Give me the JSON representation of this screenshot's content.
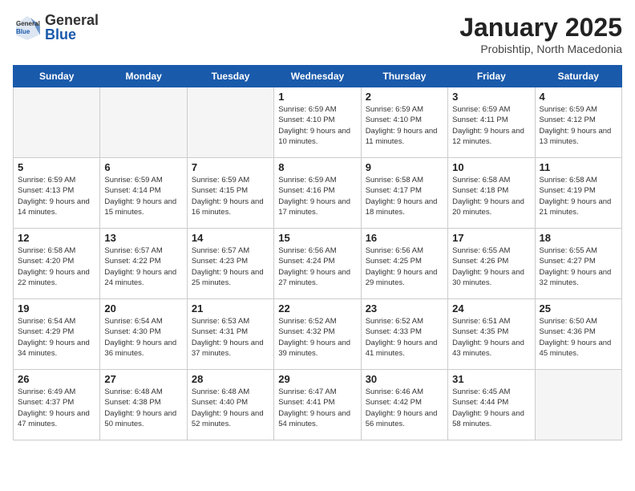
{
  "header": {
    "logo": {
      "general": "General",
      "blue": "Blue"
    },
    "title": "January 2025",
    "location": "Probishtip, North Macedonia"
  },
  "weekdays": [
    "Sunday",
    "Monday",
    "Tuesday",
    "Wednesday",
    "Thursday",
    "Friday",
    "Saturday"
  ],
  "weeks": [
    [
      {
        "day": "",
        "info": ""
      },
      {
        "day": "",
        "info": ""
      },
      {
        "day": "",
        "info": ""
      },
      {
        "day": "1",
        "info": "Sunrise: 6:59 AM\nSunset: 4:10 PM\nDaylight: 9 hours\nand 10 minutes."
      },
      {
        "day": "2",
        "info": "Sunrise: 6:59 AM\nSunset: 4:10 PM\nDaylight: 9 hours\nand 11 minutes."
      },
      {
        "day": "3",
        "info": "Sunrise: 6:59 AM\nSunset: 4:11 PM\nDaylight: 9 hours\nand 12 minutes."
      },
      {
        "day": "4",
        "info": "Sunrise: 6:59 AM\nSunset: 4:12 PM\nDaylight: 9 hours\nand 13 minutes."
      }
    ],
    [
      {
        "day": "5",
        "info": "Sunrise: 6:59 AM\nSunset: 4:13 PM\nDaylight: 9 hours\nand 14 minutes."
      },
      {
        "day": "6",
        "info": "Sunrise: 6:59 AM\nSunset: 4:14 PM\nDaylight: 9 hours\nand 15 minutes."
      },
      {
        "day": "7",
        "info": "Sunrise: 6:59 AM\nSunset: 4:15 PM\nDaylight: 9 hours\nand 16 minutes."
      },
      {
        "day": "8",
        "info": "Sunrise: 6:59 AM\nSunset: 4:16 PM\nDaylight: 9 hours\nand 17 minutes."
      },
      {
        "day": "9",
        "info": "Sunrise: 6:58 AM\nSunset: 4:17 PM\nDaylight: 9 hours\nand 18 minutes."
      },
      {
        "day": "10",
        "info": "Sunrise: 6:58 AM\nSunset: 4:18 PM\nDaylight: 9 hours\nand 20 minutes."
      },
      {
        "day": "11",
        "info": "Sunrise: 6:58 AM\nSunset: 4:19 PM\nDaylight: 9 hours\nand 21 minutes."
      }
    ],
    [
      {
        "day": "12",
        "info": "Sunrise: 6:58 AM\nSunset: 4:20 PM\nDaylight: 9 hours\nand 22 minutes."
      },
      {
        "day": "13",
        "info": "Sunrise: 6:57 AM\nSunset: 4:22 PM\nDaylight: 9 hours\nand 24 minutes."
      },
      {
        "day": "14",
        "info": "Sunrise: 6:57 AM\nSunset: 4:23 PM\nDaylight: 9 hours\nand 25 minutes."
      },
      {
        "day": "15",
        "info": "Sunrise: 6:56 AM\nSunset: 4:24 PM\nDaylight: 9 hours\nand 27 minutes."
      },
      {
        "day": "16",
        "info": "Sunrise: 6:56 AM\nSunset: 4:25 PM\nDaylight: 9 hours\nand 29 minutes."
      },
      {
        "day": "17",
        "info": "Sunrise: 6:55 AM\nSunset: 4:26 PM\nDaylight: 9 hours\nand 30 minutes."
      },
      {
        "day": "18",
        "info": "Sunrise: 6:55 AM\nSunset: 4:27 PM\nDaylight: 9 hours\nand 32 minutes."
      }
    ],
    [
      {
        "day": "19",
        "info": "Sunrise: 6:54 AM\nSunset: 4:29 PM\nDaylight: 9 hours\nand 34 minutes."
      },
      {
        "day": "20",
        "info": "Sunrise: 6:54 AM\nSunset: 4:30 PM\nDaylight: 9 hours\nand 36 minutes."
      },
      {
        "day": "21",
        "info": "Sunrise: 6:53 AM\nSunset: 4:31 PM\nDaylight: 9 hours\nand 37 minutes."
      },
      {
        "day": "22",
        "info": "Sunrise: 6:52 AM\nSunset: 4:32 PM\nDaylight: 9 hours\nand 39 minutes."
      },
      {
        "day": "23",
        "info": "Sunrise: 6:52 AM\nSunset: 4:33 PM\nDaylight: 9 hours\nand 41 minutes."
      },
      {
        "day": "24",
        "info": "Sunrise: 6:51 AM\nSunset: 4:35 PM\nDaylight: 9 hours\nand 43 minutes."
      },
      {
        "day": "25",
        "info": "Sunrise: 6:50 AM\nSunset: 4:36 PM\nDaylight: 9 hours\nand 45 minutes."
      }
    ],
    [
      {
        "day": "26",
        "info": "Sunrise: 6:49 AM\nSunset: 4:37 PM\nDaylight: 9 hours\nand 47 minutes."
      },
      {
        "day": "27",
        "info": "Sunrise: 6:48 AM\nSunset: 4:38 PM\nDaylight: 9 hours\nand 50 minutes."
      },
      {
        "day": "28",
        "info": "Sunrise: 6:48 AM\nSunset: 4:40 PM\nDaylight: 9 hours\nand 52 minutes."
      },
      {
        "day": "29",
        "info": "Sunrise: 6:47 AM\nSunset: 4:41 PM\nDaylight: 9 hours\nand 54 minutes."
      },
      {
        "day": "30",
        "info": "Sunrise: 6:46 AM\nSunset: 4:42 PM\nDaylight: 9 hours\nand 56 minutes."
      },
      {
        "day": "31",
        "info": "Sunrise: 6:45 AM\nSunset: 4:44 PM\nDaylight: 9 hours\nand 58 minutes."
      },
      {
        "day": "",
        "info": ""
      }
    ]
  ]
}
